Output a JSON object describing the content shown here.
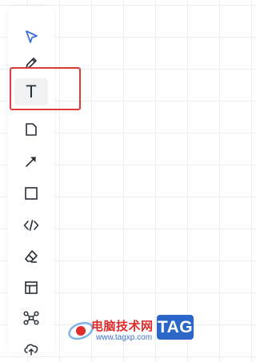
{
  "toolbar": {
    "tools": [
      {
        "name": "select",
        "icon": "cursor-arrow-icon"
      },
      {
        "name": "pencil",
        "icon": "pencil-icon"
      },
      {
        "name": "text",
        "icon": "text-icon",
        "glyph": "T",
        "active": true
      },
      {
        "name": "note",
        "icon": "note-page-icon"
      },
      {
        "name": "arrow",
        "icon": "arrow-icon"
      },
      {
        "name": "rectangle",
        "icon": "rectangle-icon"
      },
      {
        "name": "code",
        "icon": "code-icon"
      },
      {
        "name": "eraser",
        "icon": "eraser-icon"
      },
      {
        "name": "layout",
        "icon": "layout-icon"
      },
      {
        "name": "mind-map",
        "icon": "mind-map-icon"
      },
      {
        "name": "upload",
        "icon": "cloud-upload-icon"
      }
    ]
  },
  "watermark": {
    "title": "电脑技术网",
    "url": "www.tagxp.com",
    "badge": "TAG"
  },
  "colors": {
    "accent_blue": "#3a6fd8",
    "highlight_red": "#e03a3a",
    "icon": "#2a2f36"
  }
}
